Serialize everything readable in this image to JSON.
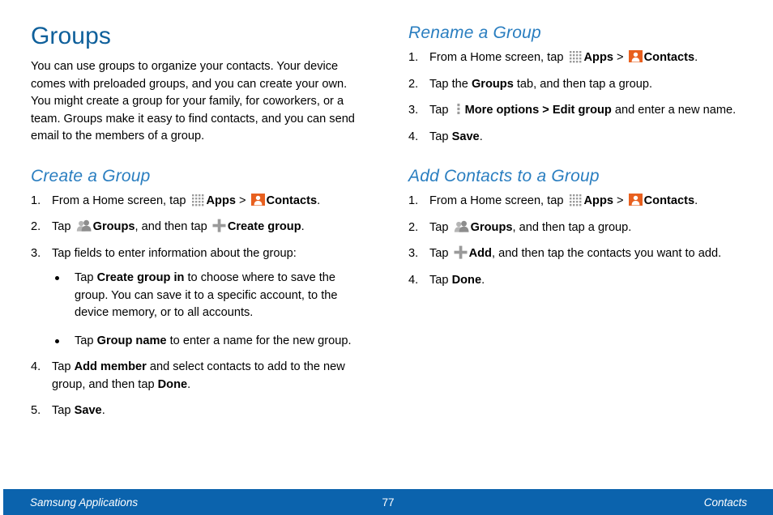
{
  "document": {
    "title": "Groups",
    "intro": "You can use groups to organize your contacts. Your device comes with preloaded groups, and you can create your own. You might create a group for your family, for coworkers, or a team. Groups make it easy to find contacts, and you can send email to the members of a group."
  },
  "colors": {
    "title_blue": "#0f609b",
    "heading_blue": "#2a7ec0",
    "footer_blue": "#0b63ad",
    "contacts_orange": "#e8601f",
    "icon_gray": "#9a9a9a"
  },
  "left_column": {
    "section": {
      "heading": "Create a Group",
      "steps": [
        {
          "num": "1.",
          "parts": [
            {
              "type": "text",
              "value": "From a Home screen, tap "
            },
            {
              "type": "icon",
              "value": "apps-grid-icon"
            },
            {
              "type": "bold",
              "value": "Apps"
            },
            {
              "type": "text",
              "value": " > "
            },
            {
              "type": "icon",
              "value": "contacts-icon"
            },
            {
              "type": "bold",
              "value": "Contacts"
            },
            {
              "type": "text",
              "value": "."
            }
          ]
        },
        {
          "num": "2.",
          "parts": [
            {
              "type": "text",
              "value": "Tap "
            },
            {
              "type": "icon",
              "value": "groups-icon"
            },
            {
              "type": "bold",
              "value": "Groups"
            },
            {
              "type": "text",
              "value": ", and then tap "
            },
            {
              "type": "icon",
              "value": "plus-icon"
            },
            {
              "type": "bold",
              "value": "Create group"
            },
            {
              "type": "text",
              "value": "."
            }
          ]
        },
        {
          "num": "3.",
          "parts": [
            {
              "type": "text",
              "value": "Tap fields to enter information about the group:"
            }
          ],
          "bullets": [
            {
              "parts": [
                {
                  "type": "text",
                  "value": "Tap "
                },
                {
                  "type": "bold",
                  "value": "Create group in"
                },
                {
                  "type": "text",
                  "value": " to choose where to save the group. You can save it to a specific account, to the device memory, or to all accounts."
                }
              ]
            },
            {
              "parts": [
                {
                  "type": "text",
                  "value": "Tap "
                },
                {
                  "type": "bold",
                  "value": "Group name"
                },
                {
                  "type": "text",
                  "value": " to enter a name for the new group."
                }
              ]
            }
          ]
        },
        {
          "num": "4.",
          "parts": [
            {
              "type": "text",
              "value": "Tap "
            },
            {
              "type": "bold",
              "value": "Add member"
            },
            {
              "type": "text",
              "value": " and select contacts to add to the new group, and then tap "
            },
            {
              "type": "bold",
              "value": "Done"
            },
            {
              "type": "text",
              "value": "."
            }
          ]
        },
        {
          "num": "5.",
          "parts": [
            {
              "type": "text",
              "value": "Tap "
            },
            {
              "type": "bold",
              "value": "Save"
            },
            {
              "type": "text",
              "value": "."
            }
          ]
        }
      ]
    }
  },
  "right_column": {
    "sections": [
      {
        "heading": "Rename a Group",
        "steps": [
          {
            "num": "1.",
            "parts": [
              {
                "type": "text",
                "value": "From a Home screen, tap "
              },
              {
                "type": "icon",
                "value": "apps-grid-icon"
              },
              {
                "type": "bold",
                "value": "Apps"
              },
              {
                "type": "text",
                "value": " > "
              },
              {
                "type": "icon",
                "value": "contacts-icon"
              },
              {
                "type": "bold",
                "value": "Contacts"
              },
              {
                "type": "text",
                "value": "."
              }
            ]
          },
          {
            "num": "2.",
            "parts": [
              {
                "type": "text",
                "value": "Tap the "
              },
              {
                "type": "bold",
                "value": "Groups"
              },
              {
                "type": "text",
                "value": " tab, and then tap a group."
              }
            ]
          },
          {
            "num": "3.",
            "parts": [
              {
                "type": "text",
                "value": "Tap "
              },
              {
                "type": "icon",
                "value": "more-options-icon"
              },
              {
                "type": "bold",
                "value": "More options"
              },
              {
                "type": "bold",
                "value": " > "
              },
              {
                "type": "bold",
                "value": "Edit group"
              },
              {
                "type": "text",
                "value": " and enter a new name."
              }
            ]
          },
          {
            "num": "4.",
            "parts": [
              {
                "type": "text",
                "value": "Tap "
              },
              {
                "type": "bold",
                "value": "Save"
              },
              {
                "type": "text",
                "value": "."
              }
            ]
          }
        ]
      },
      {
        "heading": "Add Contacts to a Group",
        "steps": [
          {
            "num": "1.",
            "parts": [
              {
                "type": "text",
                "value": "From a Home screen, tap "
              },
              {
                "type": "icon",
                "value": "apps-grid-icon"
              },
              {
                "type": "bold",
                "value": "Apps"
              },
              {
                "type": "text",
                "value": " > "
              },
              {
                "type": "icon",
                "value": "contacts-icon"
              },
              {
                "type": "bold",
                "value": "Contacts"
              },
              {
                "type": "text",
                "value": "."
              }
            ]
          },
          {
            "num": "2.",
            "parts": [
              {
                "type": "text",
                "value": "Tap "
              },
              {
                "type": "icon",
                "value": "groups-icon"
              },
              {
                "type": "bold",
                "value": "Groups"
              },
              {
                "type": "text",
                "value": ", and then tap a group."
              }
            ]
          },
          {
            "num": "3.",
            "parts": [
              {
                "type": "text",
                "value": "Tap "
              },
              {
                "type": "icon",
                "value": "plus-icon"
              },
              {
                "type": "bold",
                "value": "Add"
              },
              {
                "type": "text",
                "value": ", and then tap the contacts you want to add."
              }
            ]
          },
          {
            "num": "4.",
            "parts": [
              {
                "type": "text",
                "value": "Tap "
              },
              {
                "type": "bold",
                "value": "Done"
              },
              {
                "type": "text",
                "value": "."
              }
            ]
          }
        ]
      }
    ]
  },
  "footer": {
    "left": "Samsung Applications",
    "page_number": "77",
    "right": "Contacts"
  }
}
